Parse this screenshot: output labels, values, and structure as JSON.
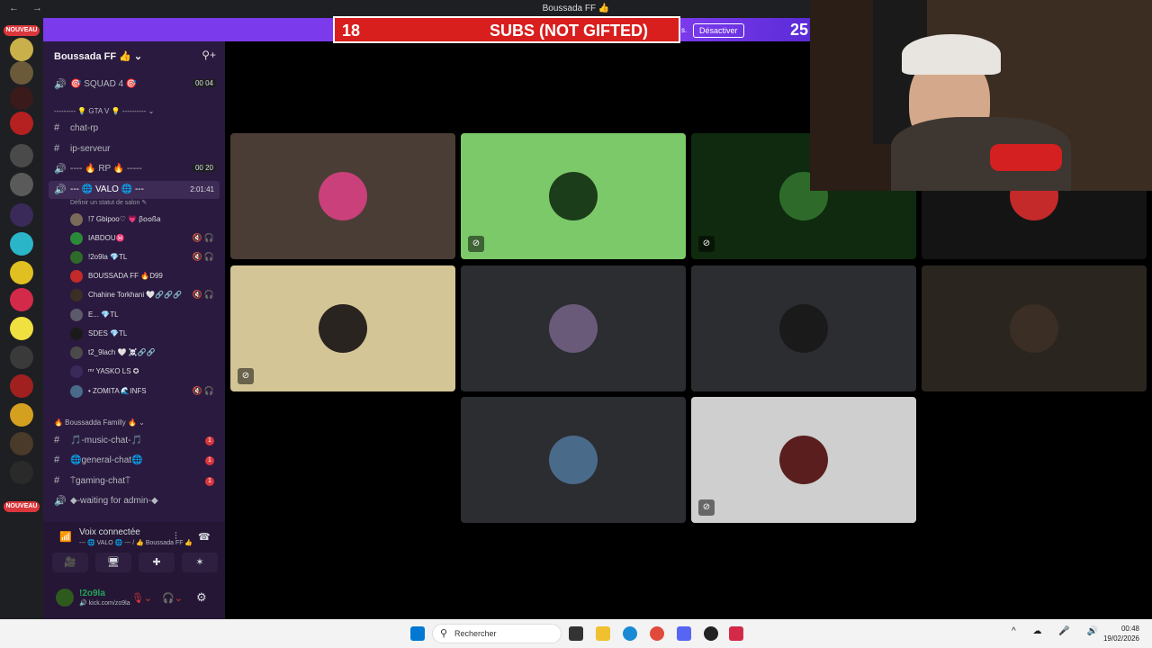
{
  "window": {
    "title": "Boussada FF 👍",
    "nav": "← →"
  },
  "overlay": {
    "sub_count": "18",
    "sub_label": "SUBS (NOT GIFTED)",
    "partial": "s.",
    "deactivate": "Désactiver",
    "right_count": "25"
  },
  "server": {
    "name": "Boussada FF 👍",
    "add_icon": "add-friend-icon"
  },
  "channels": [
    {
      "type": "voice",
      "label": "🎯 SQUAD 4 🎯",
      "counter": "00  04"
    },
    {
      "type": "category",
      "label": "--------- 💡 GTA V 💡 ---------- ⌄"
    },
    {
      "type": "text",
      "label": "chat-rp"
    },
    {
      "type": "text",
      "label": "ip-serveur"
    },
    {
      "type": "voice",
      "label": "---- 🔥 RP 🔥 -----",
      "counter": "00  20"
    },
    {
      "type": "voice",
      "label": "--- 🌐 VALO 🌐 ---",
      "time": "2:01:41",
      "status": "Définir un statut de salon ✎"
    }
  ],
  "members": [
    {
      "name": "!7 Gbipoo♡ 💗 β໐໐ßa",
      "muted": false
    },
    {
      "name": "IABDOU♓",
      "muted": true
    },
    {
      "name": "!2o9la 💎TL",
      "muted": true
    },
    {
      "name": "BOUSSADA FF 🔥D99",
      "muted": false
    },
    {
      "name": "Chahine Torkhani 🤍🔗🔗🔗",
      "muted": true
    },
    {
      "name": "E... 💎TL",
      "muted": false
    },
    {
      "name": "SDES 💎TL",
      "muted": false
    },
    {
      "name": "t2_9lach 🤍 ☠️🔗🔗",
      "muted": false
    },
    {
      "name": "ᵐʳ YASKO LS ✪",
      "muted": false
    },
    {
      "name": "• ZOMITA 🌊INFS",
      "muted": true
    }
  ],
  "category2": "🔥 Boussadda Familly 🔥 ⌄",
  "text_channels": [
    {
      "label": "🎵-music-chat-🎵",
      "unread": "1"
    },
    {
      "label": "🌐general-chat🌐",
      "unread": "1"
    },
    {
      "label": "⍑gaming-chat⍑",
      "unread": "1"
    },
    {
      "label": "◆-waiting for admin-◆",
      "unread": ""
    }
  ],
  "voice": {
    "title": "Voix connectée",
    "subtitle": "--- 🌐 VALO 🌐 --- / 👍 Boussada FF 👍"
  },
  "user": {
    "name": "!2o9la",
    "status": "🔊 kick.com/zo9la"
  },
  "guild_badges": [
    "NOUVEAU",
    "NOUVEAU"
  ],
  "tiles": [
    {
      "bg": "#4a3d35",
      "avatar": "#c9407a",
      "cam_off": false
    },
    {
      "bg": "#7cc96a",
      "avatar": "#1c3d1a",
      "cam_off": true
    },
    {
      "bg": "#0f2a0f",
      "avatar": "#2e6b2a",
      "cam_off": true
    },
    {
      "bg": "#141414",
      "avatar": "#c42a2a",
      "cam_off": false
    },
    {
      "bg": "#d4c596",
      "avatar": "#2a2420",
      "cam_off": true
    },
    {
      "bg": "#2b2d31",
      "avatar": "#6a5a7a",
      "cam_off": false
    },
    {
      "bg": "#2b2d31",
      "avatar": "#1a1a1a",
      "cam_off": false
    },
    {
      "bg": "#2a251f",
      "avatar": "#3a2e25",
      "cam_off": false
    },
    {
      "bg": "#2b2d31",
      "avatar": "#4a6a8a",
      "cam_off": false
    },
    {
      "bg": "#cfcfcf",
      "avatar": "#5a1e1e",
      "cam_off": true
    }
  ],
  "taskbar": {
    "search_placeholder": "Rechercher",
    "time": "00:48",
    "date": "19/02/2026",
    "tray": "^ ☁ 🎤 🔊"
  },
  "colors": {
    "accent": "#7c3aed",
    "danger": "#da373c",
    "online": "#23a55a"
  }
}
